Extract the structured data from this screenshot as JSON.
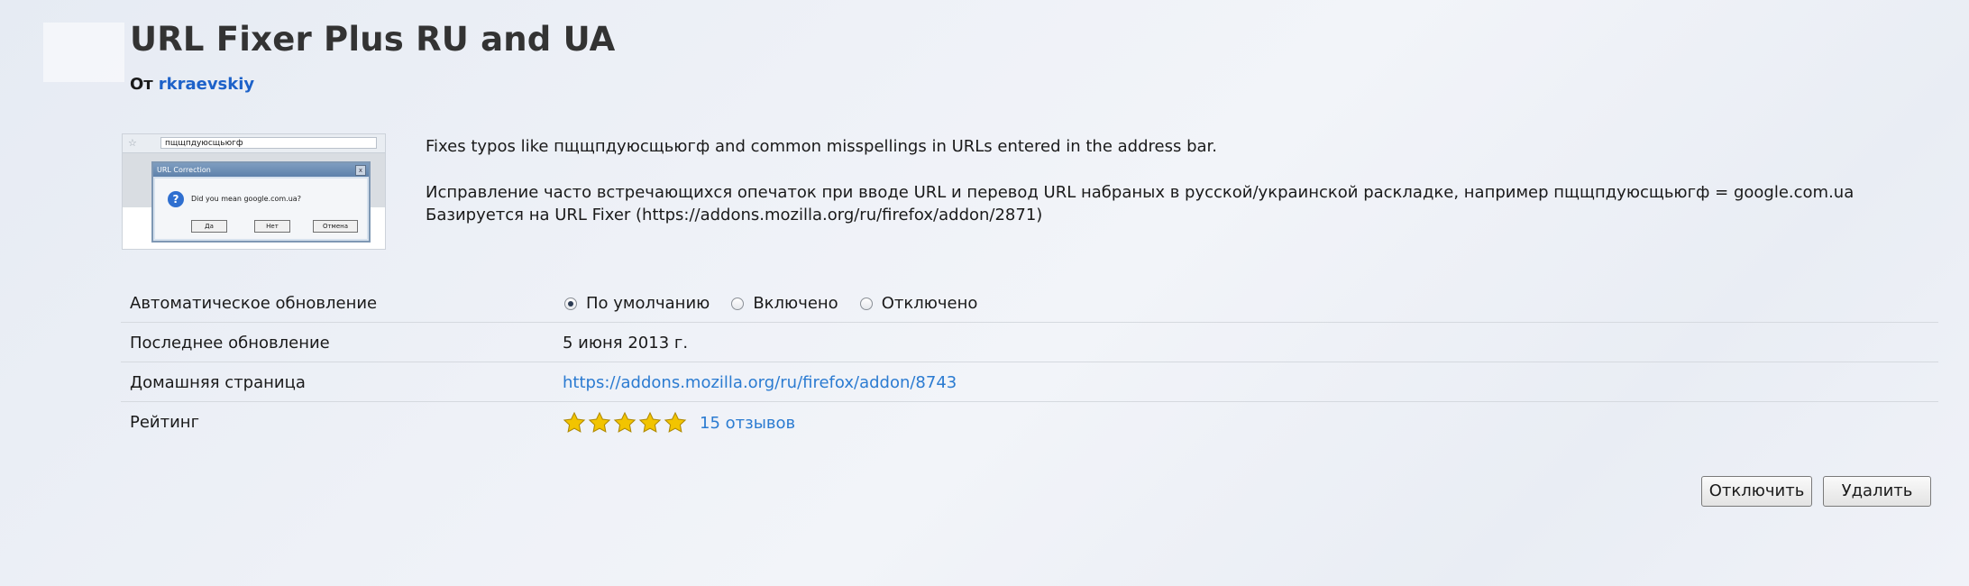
{
  "addon": {
    "title": "URL Fixer Plus RU and UA",
    "by_label": "От",
    "author": "rkraevskiy"
  },
  "thumbnail": {
    "address_text": "пщщпдуюсщьюгф",
    "dialog_title": "URL Correction",
    "dialog_close": "x",
    "dialog_icon": "?",
    "dialog_question": "Did you mean google.com.ua?",
    "buttons": [
      "Да",
      "Нет",
      "Отмена"
    ]
  },
  "description": {
    "line1": "Fixes typos like пщщпдуюсщьюгф and common misspellings in URLs entered in the address bar.",
    "line2": "Исправление часто встречающихся опечаток при вводе URL и перевод URL набраных в русской/украинской раскладке, например пщщпдуюсщьюгф = google.com.ua",
    "line3": "Базируется на URL Fixer (https://addons.mozilla.org/ru/firefox/addon/2871)"
  },
  "details": {
    "auto_update_label": "Автоматическое обновление",
    "auto_update_options": [
      "По умолчанию",
      "Включено",
      "Отключено"
    ],
    "auto_update_selected": "По умолчанию",
    "last_update_label": "Последнее обновление",
    "last_update_value": "5 июня 2013 г.",
    "homepage_label": "Домашняя страница",
    "homepage_value": "https://addons.mozilla.org/ru/firefox/addon/8743",
    "rating_label": "Рейтинг",
    "rating_stars": 5,
    "rating_max": 5,
    "reviews_text": "15 отзывов"
  },
  "actions": {
    "disable_label": "Отключить",
    "remove_label": "Удалить"
  },
  "colors": {
    "link": "#2b7bd1",
    "author": "#1d62c9",
    "star": "#f2c400"
  }
}
